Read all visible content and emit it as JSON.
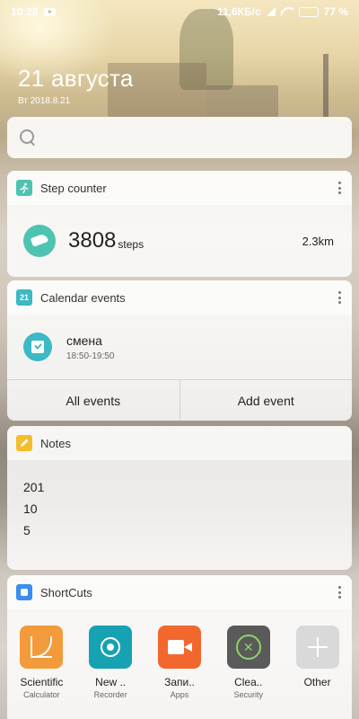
{
  "status_bar": {
    "time": "10:28",
    "network_speed": "11,6КБ/с",
    "battery_percent": "77 %",
    "battery_level": 0.77,
    "icons": [
      "youtube-icon",
      "signal-icon",
      "wifi-icon",
      "battery-icon"
    ]
  },
  "header": {
    "date_large": "21 августа",
    "date_small": "Вт 2018.8.21"
  },
  "search": {
    "placeholder": ""
  },
  "step_counter": {
    "title": "Step counter",
    "steps": "3808",
    "unit": "steps",
    "distance": "2.3km",
    "accent": "#4ec3b1"
  },
  "calendar": {
    "title": "Calendar events",
    "icon_day": "21",
    "event_name": "смена",
    "event_time": "18:50-19:50",
    "all_events_label": "All events",
    "add_event_label": "Add event",
    "accent": "#3bb9c4"
  },
  "notes": {
    "title": "Notes",
    "lines": [
      "201",
      "10",
      "5"
    ],
    "accent": "#f4bd2a"
  },
  "shortcuts": {
    "title": "ShortCuts",
    "accent": "#3a8ef0",
    "items": [
      {
        "label": "Scientific",
        "sub": "Calculator",
        "color": "#f39a3b",
        "icon": "graph-icon"
      },
      {
        "label": "New ..",
        "sub": "Recorder",
        "color": "#16a2b2",
        "icon": "record-icon"
      },
      {
        "label": "Запи..",
        "sub": "Apps",
        "color": "#f2672e",
        "icon": "video-icon"
      },
      {
        "label": "Clea..",
        "sub": "Security",
        "color": "#5a5a5a",
        "icon": "cleaner-icon"
      },
      {
        "label": "Other",
        "sub": "",
        "color": "#d9d9d9",
        "icon": "plus-icon"
      }
    ]
  }
}
